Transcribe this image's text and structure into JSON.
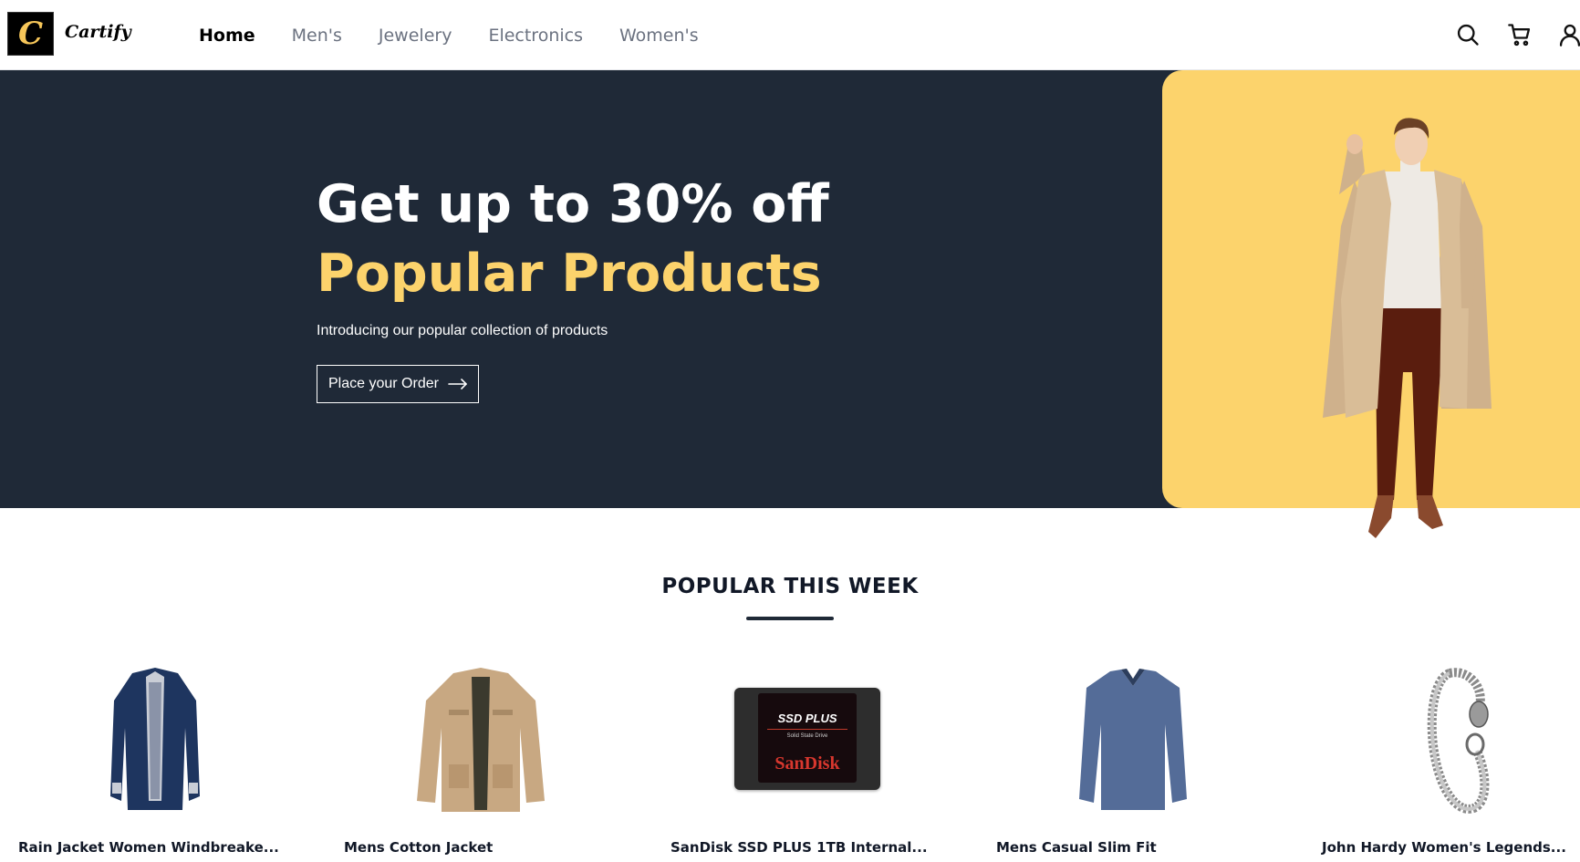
{
  "brand": {
    "logo_letter": "C",
    "name": "Cartify",
    "accent": "#fcd36c"
  },
  "nav": {
    "items": [
      {
        "label": "Home",
        "active": true
      },
      {
        "label": "Men's",
        "active": false
      },
      {
        "label": "Jewelery",
        "active": false
      },
      {
        "label": "Electronics",
        "active": false
      },
      {
        "label": "Women's",
        "active": false
      }
    ]
  },
  "header_icons": [
    "search-icon",
    "cart-icon",
    "user-icon"
  ],
  "hero": {
    "title_line1": "Get up to 30% off",
    "title_line2": "Popular Products",
    "subtitle": "Introducing our popular collection of products",
    "cta_label": "Place your Order",
    "background": "#1f2937"
  },
  "popular": {
    "title": "POPULAR THIS WEEK",
    "products": [
      {
        "name": "Rain Jacket Women Windbreake..."
      },
      {
        "name": "Mens Cotton Jacket"
      },
      {
        "name": "SanDisk SSD PLUS 1TB Internal..."
      },
      {
        "name": "Mens Casual Slim Fit"
      },
      {
        "name": "John Hardy Women's Legends..."
      }
    ],
    "ssd_brand": "SanDisk",
    "ssd_model": "SSD PLUS",
    "ssd_type": "Solid State Drive"
  }
}
